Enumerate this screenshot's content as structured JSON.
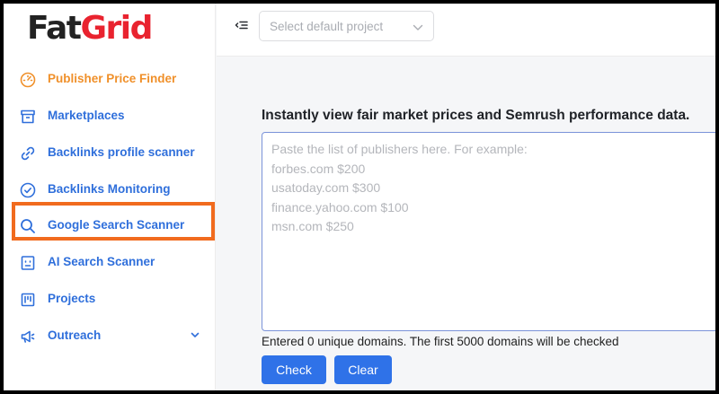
{
  "logo": {
    "part1": "Fat",
    "part2": "Grid"
  },
  "sidebar": {
    "items": [
      {
        "label": "Publisher Price Finder",
        "icon": "gauge-icon",
        "active": true
      },
      {
        "label": "Marketplaces",
        "icon": "archive-box-icon"
      },
      {
        "label": "Backlinks profile scanner",
        "icon": "link-icon"
      },
      {
        "label": "Backlinks Monitoring",
        "icon": "check-circle-icon"
      },
      {
        "label": "Google Search Scanner",
        "icon": "search-icon",
        "highlighted": true
      },
      {
        "label": "AI Search Scanner",
        "icon": "robot-face-icon"
      },
      {
        "label": "Projects",
        "icon": "kanban-board-icon"
      },
      {
        "label": "Outreach",
        "icon": "megaphone-icon",
        "expandable": true
      }
    ]
  },
  "topbar": {
    "project_placeholder": "Select default project"
  },
  "main": {
    "title": "Instantly view fair market prices and Semrush performance data.",
    "textarea_placeholder": "Paste the list of publishers here. For example:\nforbes.com $200\nusatoday.com $300\nfinance.yahoo.com $100\nmsn.com $250",
    "textarea_value": "",
    "domain_count_text": "Entered 0 unique domains. The first 5000 domains will be checked",
    "check_label": "Check",
    "clear_label": "Clear"
  },
  "colors": {
    "accent_blue": "#2f72e8",
    "nav_blue": "#2f6fdb",
    "active_orange": "#f0902a",
    "highlight_orange": "#f16b1e",
    "brand_red": "#e9232f"
  }
}
